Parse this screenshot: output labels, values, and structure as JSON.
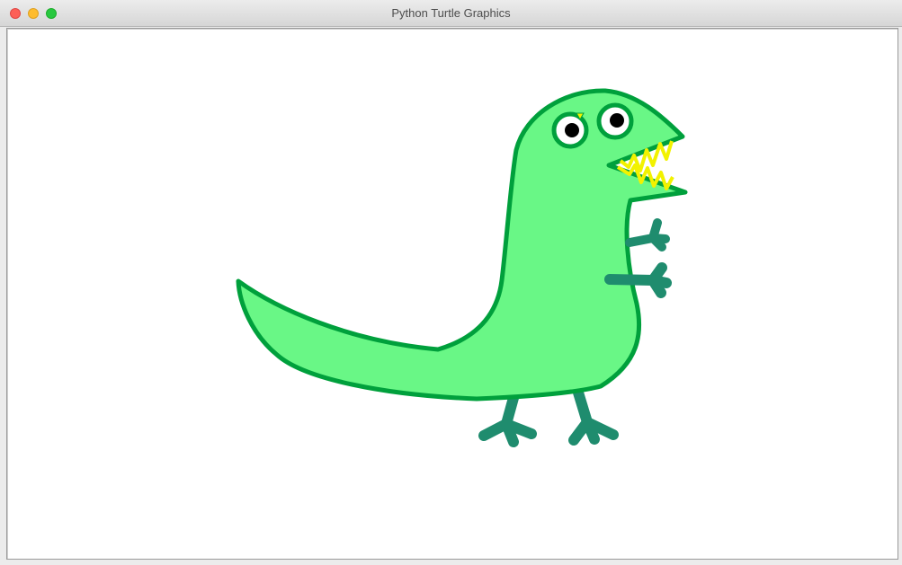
{
  "window": {
    "title": "Python Turtle Graphics"
  },
  "colors": {
    "outline": "#00a03c",
    "body_fill": "#69f786",
    "limbs": "#1f8c6e",
    "teeth": "#f2f200",
    "eye_white": "#ffffff",
    "pupil": "#000000"
  },
  "icons": {
    "close": "close-icon",
    "minimize": "minimize-icon",
    "zoom": "zoom-icon"
  }
}
